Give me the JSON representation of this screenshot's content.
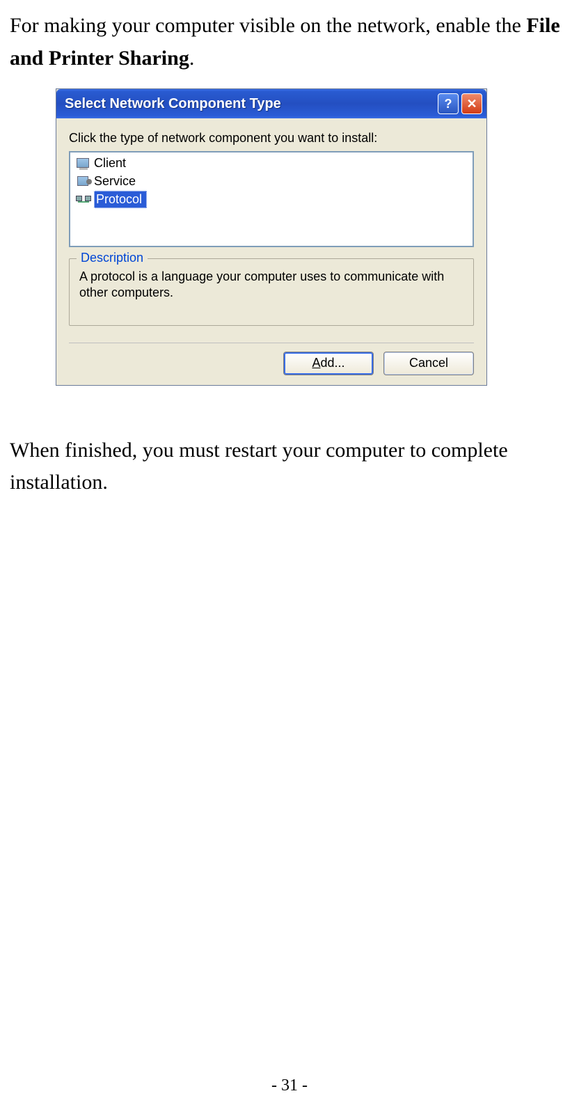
{
  "doc": {
    "intro_part1": "For making your computer visible on the network, enable the ",
    "intro_bold": "File and Printer Sharing",
    "intro_part2": ".",
    "after_dialog": "When finished, you must restart your computer to complete installation.",
    "page_number": "- 31 -"
  },
  "dialog": {
    "title": "Select Network Component Type",
    "instruction": "Click the type of network component you want to install:",
    "list": {
      "items": [
        {
          "label": "Client",
          "selected": false
        },
        {
          "label": "Service",
          "selected": false
        },
        {
          "label": "Protocol",
          "selected": true
        }
      ]
    },
    "description": {
      "title": "Description",
      "body": "A protocol is a language your computer uses to communicate with other computers."
    },
    "buttons": {
      "add_prefix": "A",
      "add_rest": "dd...",
      "cancel": "Cancel"
    }
  }
}
